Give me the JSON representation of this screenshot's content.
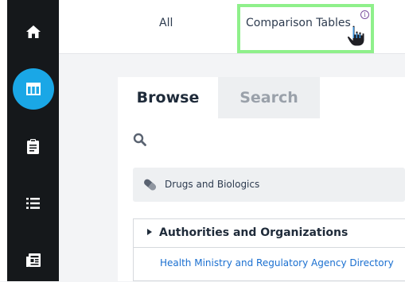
{
  "sidebar": {
    "items": [
      {
        "icon": "home-icon"
      },
      {
        "icon": "table-icon",
        "active": true
      },
      {
        "icon": "clipboard-icon"
      },
      {
        "icon": "list-icon"
      },
      {
        "icon": "newspaper-icon"
      }
    ]
  },
  "header": {
    "tabs": [
      {
        "label": "All"
      },
      {
        "label": "Comparison Tables",
        "info": "i"
      }
    ]
  },
  "content": {
    "tabs": [
      {
        "label": "Browse",
        "active": true
      },
      {
        "label": "Search"
      }
    ],
    "filter": {
      "label": "Drugs and Biologics"
    },
    "tree": {
      "heading": "Authorities and Organizations",
      "link": "Health Ministry and Regulatory Agency Directory"
    }
  },
  "colors": {
    "sidebar_bg": "#15181b",
    "active_accent": "#1aa7e6",
    "highlight_border": "#8ff08b",
    "link": "#1a6fd0"
  }
}
